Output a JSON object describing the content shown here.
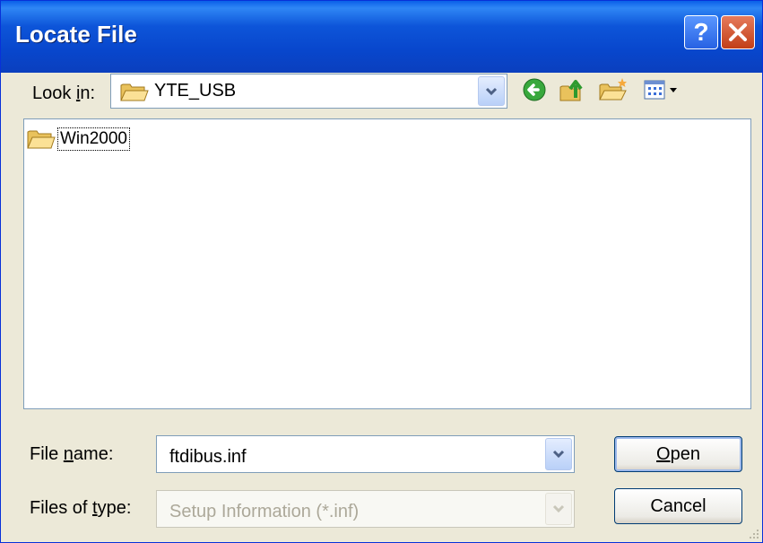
{
  "title": "Locate File",
  "look_in": {
    "label_pre": "Look ",
    "label_ul": "i",
    "label_post": "n:",
    "value": "YTE_USB"
  },
  "files": [
    {
      "name": "Win2000",
      "icon": "folder-icon"
    }
  ],
  "file_name": {
    "label_pre": "File ",
    "label_ul": "n",
    "label_post": "ame:",
    "value": "ftdibus.inf"
  },
  "files_of_type": {
    "label_pre": "Files of ",
    "label_ul": "t",
    "label_post": "ype:",
    "value": "Setup Information (*.inf)"
  },
  "buttons": {
    "open_ul": "O",
    "open_rest": "pen",
    "cancel": "Cancel"
  },
  "toolbar": {
    "back": "back-icon",
    "up": "up-folder-icon",
    "new_folder": "new-folder-icon",
    "view": "view-menu-icon"
  },
  "colors": {
    "title_bar": "#0846CC",
    "close": "#C23F17",
    "help": "#2762E3",
    "background": "#ECE9D8"
  }
}
